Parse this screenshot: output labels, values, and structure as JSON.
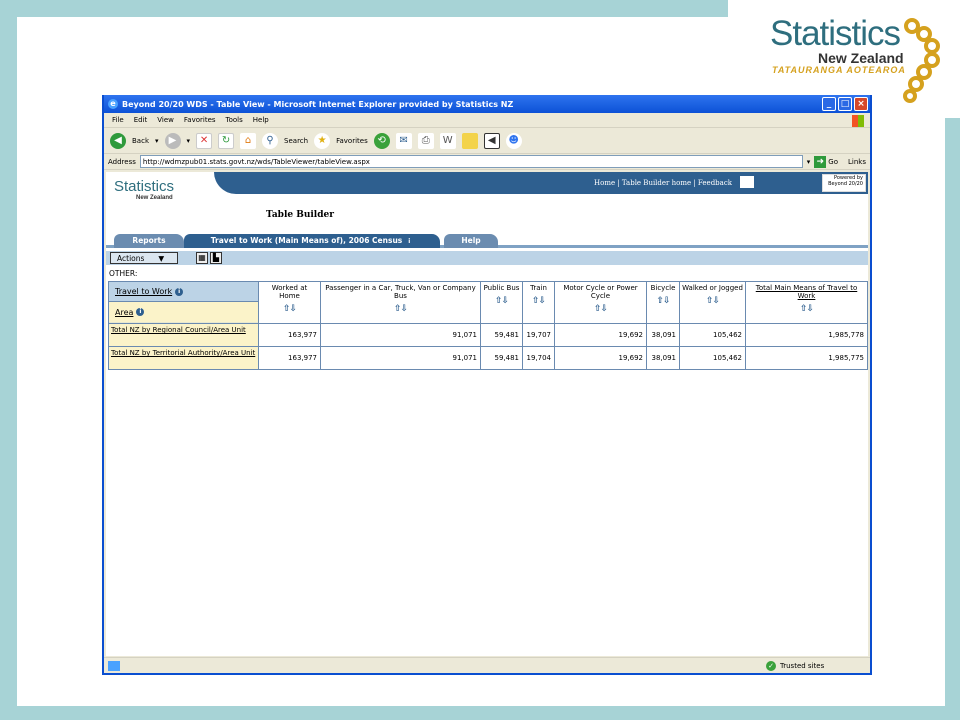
{
  "logo": {
    "word": "Statistics",
    "country": "New Zealand",
    "maori": "TATAURANGA AOTEAROA"
  },
  "browser": {
    "title": "Beyond 20/20 WDS - Table View - Microsoft Internet Explorer provided by Statistics NZ",
    "menu": [
      "File",
      "Edit",
      "View",
      "Favorites",
      "Tools",
      "Help"
    ],
    "toolbar": {
      "back": "Back",
      "search": "Search",
      "favorites": "Favorites"
    },
    "address_label": "Address",
    "url": "http://wdmzpub01.stats.govt.nz/wds/TableViewer/tableView.aspx",
    "go": "Go",
    "links": "Links",
    "status": "Trusted sites"
  },
  "site": {
    "small_logo": "Statistics",
    "small_logo_nz": "New Zealand",
    "nav": "Home | Table Builder home | Feedback",
    "powered": "Powered by Beyond 20/20",
    "heading": "Table Builder",
    "tabs": [
      "Reports",
      "Travel to Work (Main Means of), 2006 Census",
      "Help"
    ],
    "actions": "Actions",
    "other": "OTHER:"
  },
  "table": {
    "dim_col": "Travel to Work",
    "dim_row": "Area",
    "columns": [
      "Worked at Home",
      "Passenger in a Car, Truck, Van or Company Bus",
      "Public Bus",
      "Train",
      "Motor Cycle or Power Cycle",
      "Bicycle",
      "Walked or Jogged",
      "Total Main Means of Travel to Work"
    ],
    "rows": [
      {
        "label": "Total NZ by Regional Council/Area Unit",
        "values": [
          "163,977",
          "91,071",
          "59,481",
          "19,707",
          "19,692",
          "38,091",
          "105,462",
          "1,985,778"
        ]
      },
      {
        "label": "Total NZ by Territorial Authority/Area Unit",
        "values": [
          "163,977",
          "91,071",
          "59,481",
          "19,704",
          "19,692",
          "38,091",
          "105,462",
          "1,985,775"
        ]
      }
    ]
  }
}
